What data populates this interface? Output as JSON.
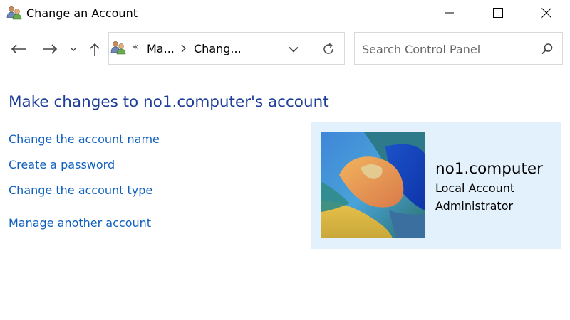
{
  "window": {
    "title": "Change an Account",
    "icon": "user-accounts-icon",
    "buttons": [
      "minimize-icon",
      "maximize-icon",
      "close-icon"
    ]
  },
  "nav": {
    "breadcrumb": {
      "overflow": "«",
      "segments": [
        "Ma...",
        "Chang..."
      ]
    },
    "search": {
      "placeholder": "Search Control Panel",
      "value": ""
    }
  },
  "content": {
    "title": "Make changes to no1.computer's account",
    "links": [
      "Change the account name",
      "Create a password",
      "Change the account type",
      "Manage another account"
    ],
    "account": {
      "name": "no1.computer",
      "type": "Local Account",
      "role": "Administrator"
    }
  },
  "colors": {
    "title": "#1e3f99",
    "link": "#0f5fbe",
    "panel": "#e3f1fc"
  }
}
